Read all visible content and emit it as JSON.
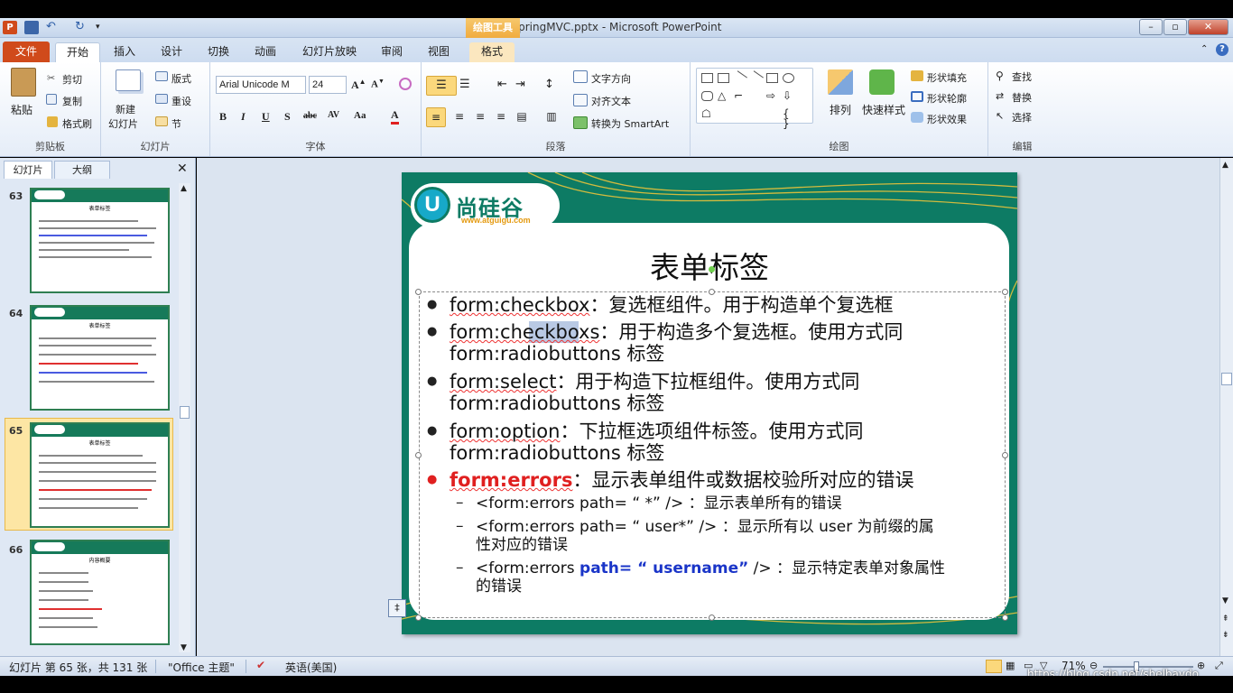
{
  "window": {
    "title": "SpringMVC.pptx - Microsoft PowerPoint",
    "contextual_tab_group": "绘图工具"
  },
  "tabs": [
    "文件",
    "开始",
    "插入",
    "设计",
    "切换",
    "动画",
    "幻灯片放映",
    "审阅",
    "视图",
    "格式"
  ],
  "active_tab": "开始",
  "ribbon": {
    "clipboard": {
      "label": "剪贴板",
      "paste": "粘贴",
      "cut": "剪切",
      "copy": "复制",
      "format_painter": "格式刷"
    },
    "slides": {
      "label": "幻灯片",
      "new_slide": "新建",
      "new_slide2": "幻灯片",
      "layout": "版式",
      "reset": "重设",
      "section": "节"
    },
    "font": {
      "label": "字体",
      "font_name": "Arial Unicode M",
      "font_size": "24"
    },
    "paragraph": {
      "label": "段落",
      "text_direction": "文字方向",
      "align_text": "对齐文本",
      "convert_smartart": "转换为 SmartArt"
    },
    "drawing": {
      "label": "绘图",
      "arrange": "排列",
      "quick_styles": "快速样式",
      "shape_fill": "形状填充",
      "shape_outline": "形状轮廓",
      "shape_effects": "形状效果"
    },
    "editing": {
      "label": "编辑",
      "find": "查找",
      "replace": "替换",
      "select": "选择"
    }
  },
  "left_pane": {
    "tab_slides": "幻灯片",
    "tab_outline": "大纲",
    "thumbnails": [
      {
        "num": "63",
        "title": "表单标签"
      },
      {
        "num": "64",
        "title": "表单标签"
      },
      {
        "num": "65",
        "title": "表单标签",
        "selected": true
      },
      {
        "num": "66",
        "title": "内容概要"
      }
    ]
  },
  "slide": {
    "logo_text": "尚硅谷",
    "logo_url": "www.atguigu.com",
    "title": "表单标签",
    "bullets": [
      {
        "term": "form:checkbox",
        "text": "：复选框组件。用于构造单个复选框"
      },
      {
        "term": "form:checkboxs",
        "text": "：用于构造多个复选框。使用方式同",
        "cont": "form:radiobuttons 标签"
      },
      {
        "term": "form:select",
        "text": "：用于构造下拉框组件。使用方式同",
        "cont": "form:radiobuttons 标签"
      },
      {
        "term": "form:option",
        "text": "：下拉框选项组件标签。使用方式同",
        "cont": "form:radiobuttons 标签"
      },
      {
        "term": "form:errors",
        "text": "：显示表单组件或数据校验所对应的错误"
      }
    ],
    "sub_bullets": [
      {
        "text": "<form:errors path= “ *” /> ：显示表单所有的错误"
      },
      {
        "text": "<form:errors path= “ user*” /> ：显示所有以 user 为前缀的属",
        "cont": "性对应的错误"
      },
      {
        "pre": "<form:errors ",
        "bold": "path= “ username”",
        "post": " /> ：显示特定表单对象属性",
        "cont": "的错误"
      }
    ]
  },
  "status": {
    "slide_info": "幻灯片 第 65 张，共 131 张",
    "theme": "\"Office 主题\"",
    "language": "英语(美国)",
    "zoom": "71%",
    "watermark": "https://blog.csdn.net/shelbaydo"
  },
  "colors": {
    "accent": "#d04a1b",
    "slide_green": "#0d7b64",
    "red_term": "#e02020",
    "blue_term": "#1a35c8"
  }
}
